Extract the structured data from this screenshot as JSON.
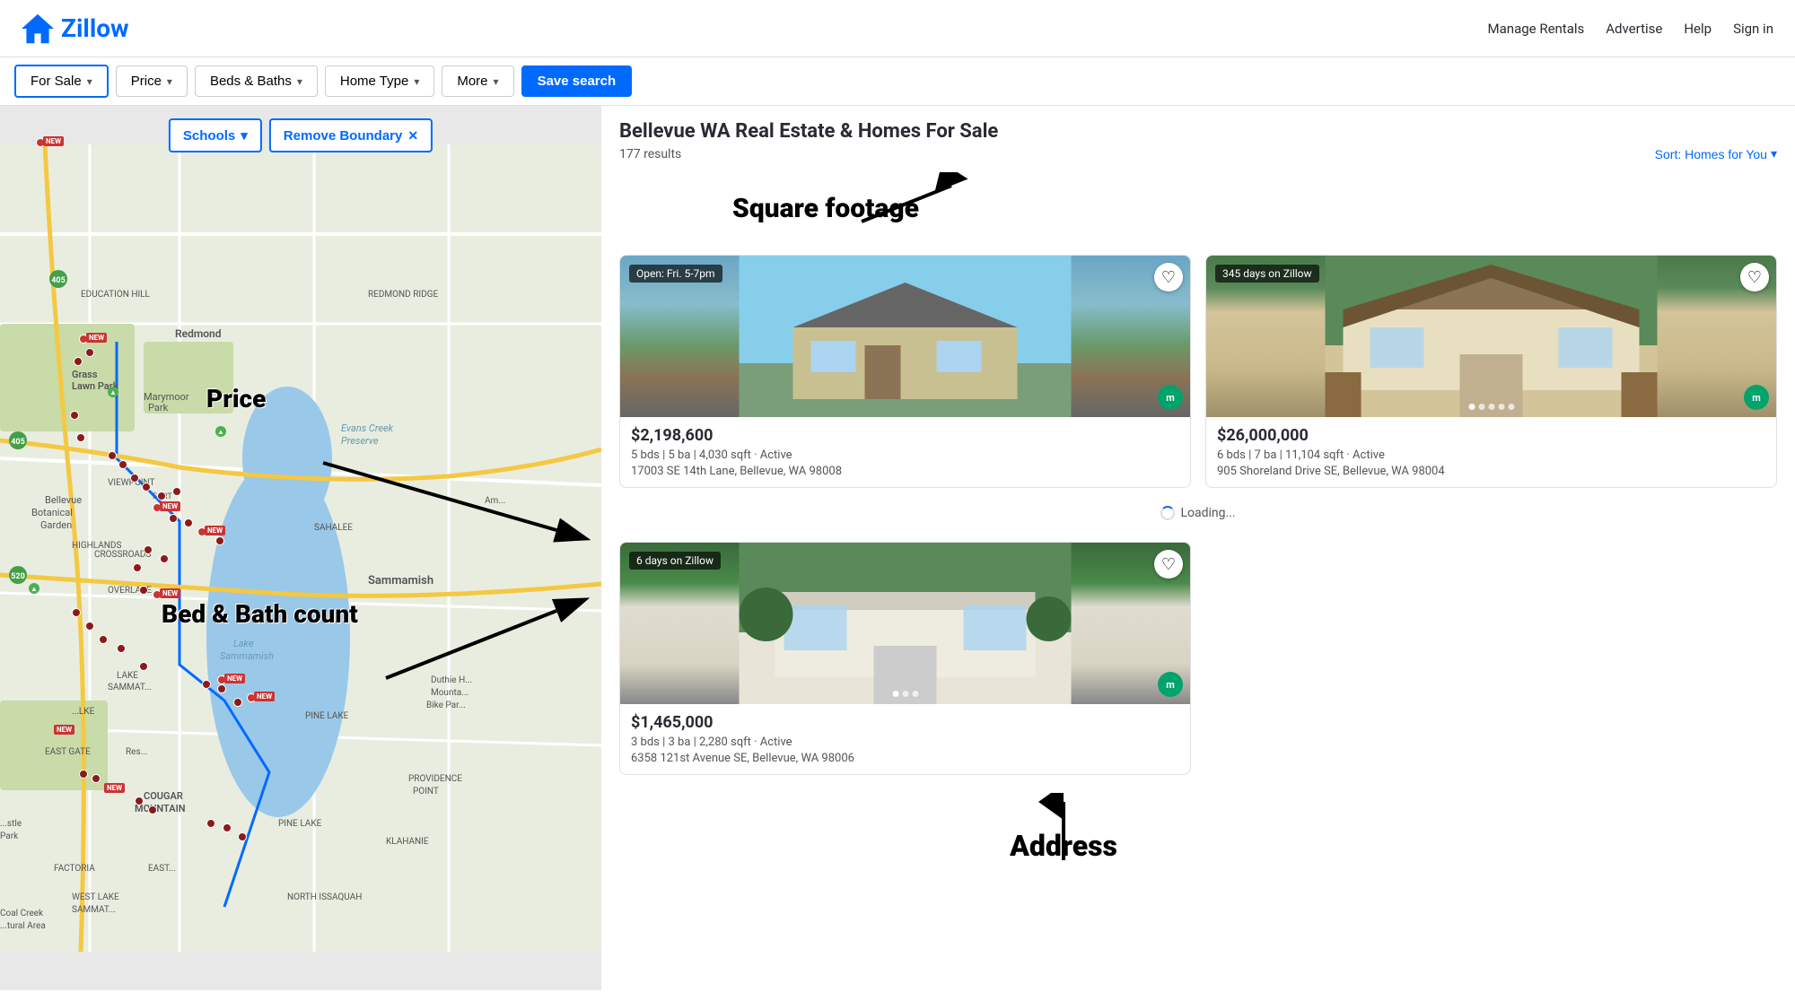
{
  "header": {
    "logo_text": "Zillow",
    "nav": {
      "manage_rentals": "Manage Rentals",
      "advertise": "Advertise",
      "help": "Help",
      "sign_in": "Sign in"
    }
  },
  "toolbar": {
    "filter_for_sale": "For Sale",
    "filter_price": "Price",
    "filter_beds_baths": "Beds & Baths",
    "filter_home_type": "Home Type",
    "filter_more": "More",
    "save_search": "Save search"
  },
  "map": {
    "schools_btn": "Schools",
    "remove_boundary_btn": "Remove Boundary"
  },
  "annotations": {
    "price_label": "Price",
    "bed_bath_label": "Bed & Bath count",
    "square_footage_label": "Square footage",
    "address_label": "Address"
  },
  "listings": {
    "title": "Bellevue WA Real Estate & Homes For Sale",
    "count": "177 results",
    "sort_label": "Sort: Homes for You",
    "loading_text": "Loading...",
    "cards": [
      {
        "id": 1,
        "badge": "Open: Fri. 5-7pm",
        "price": "$2,198,600",
        "details": "5 bds  |  5 ba  |  4,030 sqft · Active",
        "address": "17003 SE 14th Lane, Bellevue, WA 98008",
        "days_on_zillow": ""
      },
      {
        "id": 2,
        "badge": "345 days on Zillow",
        "price": "$26,000,000",
        "details": "6 bds  |  7 ba  |  11,104 sqft · Active",
        "address": "905 Shoreland Drive SE, Bellevue, WA 98004",
        "days_on_zillow": "345 days on Zillow"
      },
      {
        "id": 3,
        "badge": "6 days on Zillow",
        "price": "$1,465,000",
        "details": "3 bds  |  3 ba  |  2,280 sqft · Active",
        "address": "6358 121st Avenue SE, Bellevue, WA 98006",
        "days_on_zillow": "6 days on Zillow"
      }
    ]
  }
}
